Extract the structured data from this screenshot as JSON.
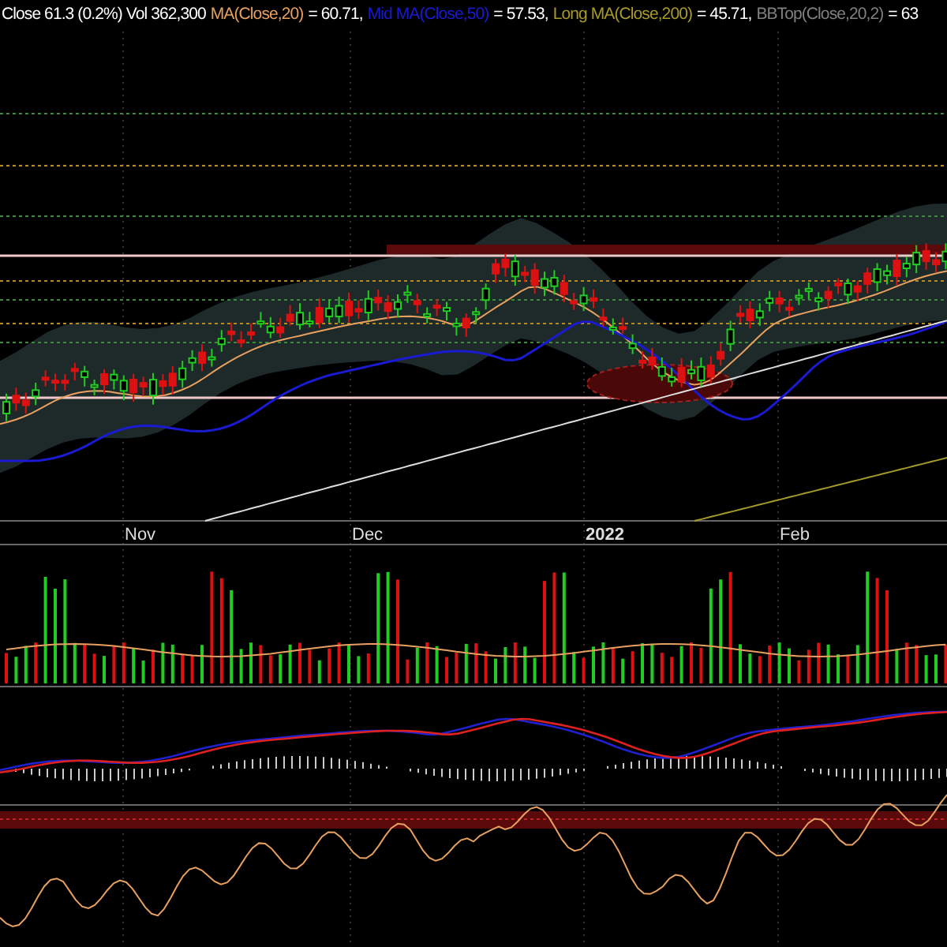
{
  "legend": {
    "quote": "Close 61.3 (0.2%) Vol 362,300",
    "indicators": [
      {
        "label": "MA(Close,20)",
        "color": "#e8a060",
        "value": "= 60.71,"
      },
      {
        "label": "Mid MA(Close,50)",
        "color": "#1a1ad0",
        "value": "= 57.53,"
      },
      {
        "label": "Long MA(Close,200)",
        "color": "#a89a28",
        "value": "= 45.71,"
      },
      {
        "label": "BBTop(Close,20,2)",
        "color": "#808080",
        "value": "= 63"
      }
    ]
  },
  "x_axis": [
    {
      "label": "Nov",
      "major": false
    },
    {
      "label": "Dec",
      "major": false
    },
    {
      "label": "2022",
      "major": true
    },
    {
      "label": "Feb",
      "major": false
    }
  ]
}
